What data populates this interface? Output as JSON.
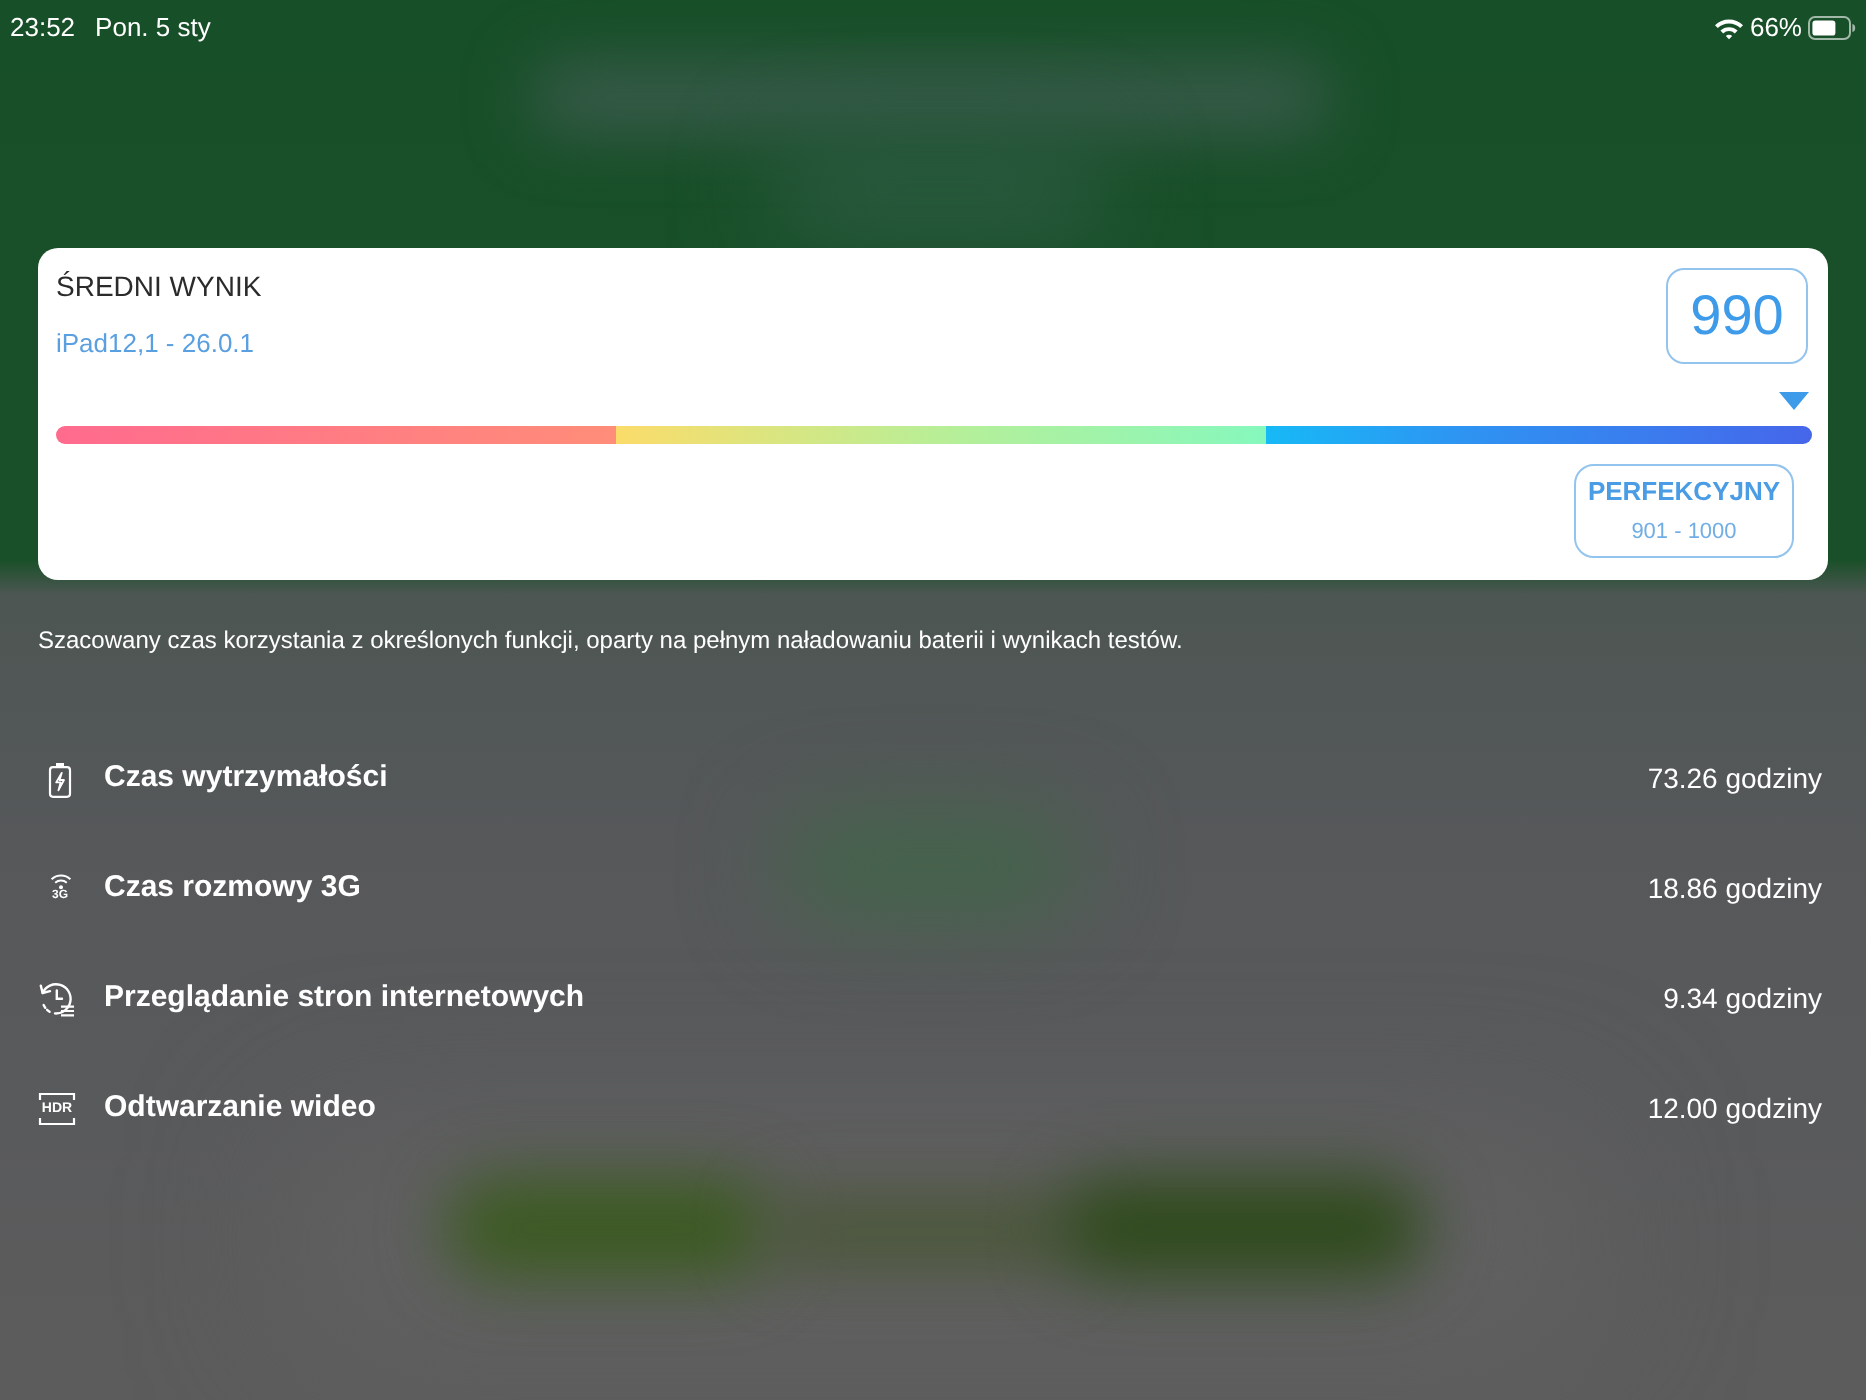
{
  "status_bar": {
    "time": "23:52",
    "date": "Pon. 5 sty",
    "battery_percent": "66%"
  },
  "score_card": {
    "title": "ŚREDNI WYNIK",
    "device": "iPad12,1 - 26.0.1",
    "score": "990",
    "level": 0.99,
    "rating": {
      "label": "PERFEKCYJNY",
      "range": "901 - 1000"
    }
  },
  "note": "Szacowany czas korzystania z określonych funkcji, oparty na pełnym naładowaniu baterii i wynikach testów.",
  "metrics": [
    {
      "kind": "battery",
      "label": "Czas wytrzymałości",
      "value": "73.26 godziny"
    },
    {
      "kind": "call",
      "icon_text": "3G",
      "label": "Czas rozmowy 3G",
      "value": "18.86 godziny"
    },
    {
      "kind": "browsing",
      "label": "Przeglądanie stron internetowych",
      "value": "9.34 godziny"
    },
    {
      "kind": "video",
      "icon_text": "HDR",
      "label": "Odtwarzanie wideo",
      "value": "12.00 godziny"
    }
  ]
}
